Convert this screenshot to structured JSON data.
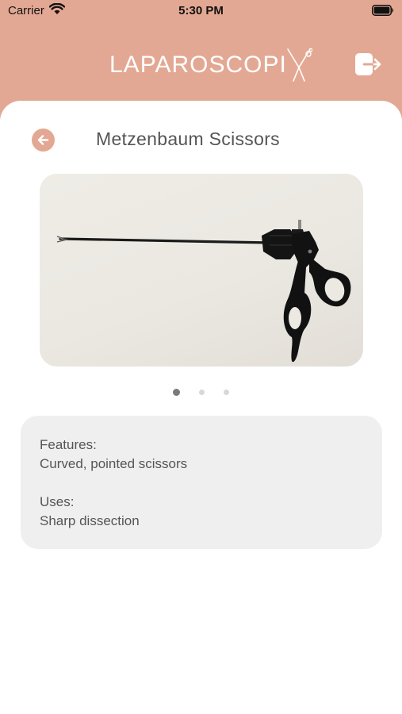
{
  "status_bar": {
    "carrier": "Carrier",
    "time": "5:30 PM"
  },
  "header": {
    "logo_text": "LAPAROSCOPI",
    "logout_icon": "logout-icon"
  },
  "detail": {
    "title": "Metzenbaum Scissors",
    "back_icon": "back-arrow-icon",
    "carousel": {
      "image_subject": "metzenbaum-scissors-photo",
      "slide_count": 3,
      "active_index": 0
    },
    "features_label": "Features:",
    "features_value": "Curved, pointed scissors",
    "uses_label": "Uses:",
    "uses_value": "Sharp dissection"
  },
  "colors": {
    "brand": "#e3a893",
    "card_bg": "#efefef",
    "text": "#555555"
  }
}
